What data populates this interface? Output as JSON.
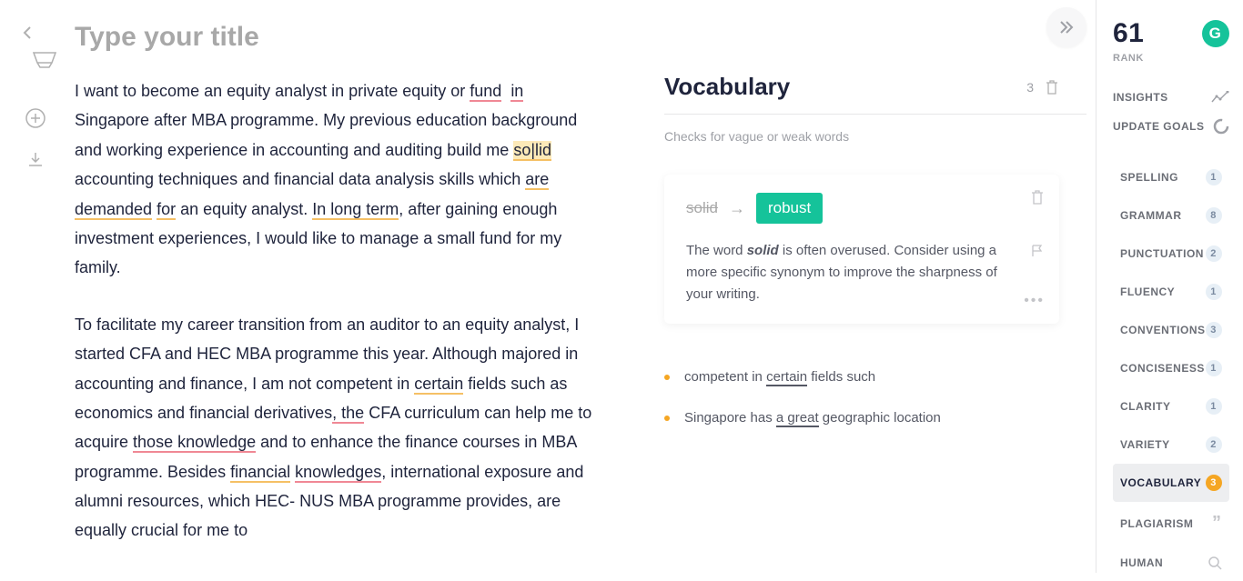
{
  "leftRail": {},
  "editor": {
    "titlePlaceholder": "Type your title"
  },
  "middle": {
    "header": "Vocabulary",
    "count": "3",
    "subtitle": "Checks for vague or weak words",
    "card": {
      "original": "solid",
      "replacement": "robust",
      "descPrefix": "The word ",
      "descEm": "solid",
      "descSuffix": " is often overused. Consider using a more specific synonym to improve the sharpness of your writing."
    },
    "items": [
      {
        "prefix": "competent in ",
        "target": "certain",
        "suffix": " fields such"
      },
      {
        "prefix": "Singapore has ",
        "target": "a great",
        "suffix": " geographic location"
      }
    ]
  },
  "right": {
    "rank": "61",
    "rankLabel": "RANK",
    "insights": "INSIGHTS",
    "updateGoals": "UPDATE GOALS",
    "categories": [
      {
        "name": "SPELLING",
        "badge": "1"
      },
      {
        "name": "GRAMMAR",
        "badge": "8"
      },
      {
        "name": "PUNCTUATION",
        "badge": "2"
      },
      {
        "name": "FLUENCY",
        "badge": "1"
      },
      {
        "name": "CONVENTIONS",
        "badge": "3"
      },
      {
        "name": "CONCISENESS",
        "badge": "1"
      },
      {
        "name": "CLARITY",
        "badge": "1"
      },
      {
        "name": "VARIETY",
        "badge": "2"
      },
      {
        "name": "VOCABULARY",
        "badge": "3",
        "selected": true,
        "badgeClass": "orange"
      },
      {
        "name": "PLAGIARISM"
      },
      {
        "name": "HUMAN"
      }
    ]
  }
}
